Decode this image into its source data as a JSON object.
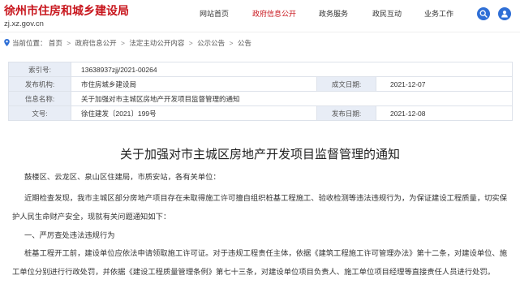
{
  "header": {
    "site_title": "徐州市住房和城乡建设局",
    "domain": "zj.xz.gov.cn",
    "nav": [
      {
        "label": "网站首页",
        "active": false
      },
      {
        "label": "政府信息公开",
        "active": true
      },
      {
        "label": "政务服务",
        "active": false
      },
      {
        "label": "政民互动",
        "active": false
      },
      {
        "label": "业务工作",
        "active": false
      }
    ],
    "icons": [
      "search-icon",
      "user-icon"
    ]
  },
  "breadcrumb": {
    "icon": "location-pin-icon",
    "prefix": "当前位置：",
    "separator": ">",
    "items": [
      "首页",
      "政府信息公开",
      "法定主动公开内容",
      "公示公告",
      "公告"
    ]
  },
  "meta_table": {
    "index": {
      "label": "索引号:",
      "value": "13638937zjj/2021-00264"
    },
    "publisher": {
      "label": "发布机构:",
      "value": "市住房城乡建设局"
    },
    "written_date": {
      "label": "成文日期:",
      "value": "2021-12-07"
    },
    "info_name": {
      "label": "信息名称:",
      "value": "关于加强对市主城区房地产开发项目监督管理的通知"
    },
    "doc_number": {
      "label": "文号:",
      "value": "徐住建发〔2021〕199号"
    },
    "publish_date": {
      "label": "发布日期:",
      "value": "2021-12-08"
    }
  },
  "article": {
    "title": "关于加强对市主城区房地产开发项目监督管理的通知",
    "lines": [
      "鼓楼区、云龙区、泉山区住建局，市质安站，各有关单位：",
      "近期检查发现，我市主城区部分房地产项目存在未取得施工许可擅自组织桩基工程施工、验收检测等违法违规行为，为保证建设工程质量，切实保",
      "护人民生命财产安全，现就有关问题通知如下：",
      "一、严厉查处违法违规行为",
      "桩基工程开工前，建设单位应依法申请领取施工许可证。对于违规工程责任主体，依据《建筑工程施工许可管理办法》第十二条，对建设单位、施",
      "工单位分别进行行政处罚，并依据《建设工程质量管理条例》第七十三条，对建设单位项目负责人、施工单位项目经理等直接责任人员进行处罚。"
    ]
  },
  "colors": {
    "brand_red": "#c8161d",
    "icon_blue": "#2f6fd6",
    "label_bg": "#e8edf6",
    "text": "#333333"
  }
}
